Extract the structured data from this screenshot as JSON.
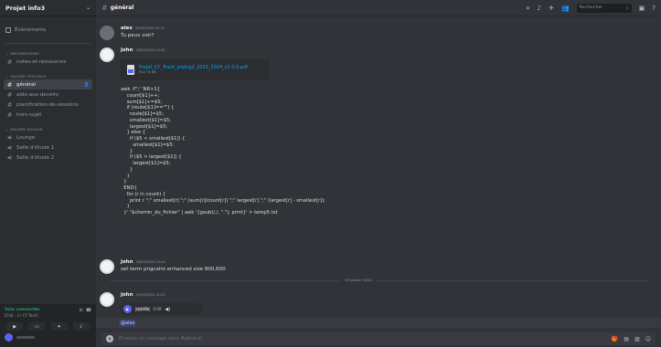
{
  "server": {
    "name": "Projet info3",
    "chevron_icon": "chevron-down-icon"
  },
  "sidebar": {
    "events_label": "Événements",
    "categories": [
      {
        "label": "INFORMATIONS",
        "channels": [
          {
            "label": "notes-et-ressources",
            "type": "text"
          }
        ]
      },
      {
        "label": "SALONS TEXTUELS",
        "channels": [
          {
            "label": "général",
            "type": "text",
            "active": true
          },
          {
            "label": "aide-aux-devoirs",
            "type": "text"
          },
          {
            "label": "planification-de-sessions",
            "type": "text"
          },
          {
            "label": "hors-sujet",
            "type": "text"
          }
        ]
      },
      {
        "label": "SALONS VOCAUX",
        "channels": [
          {
            "label": "Lounge",
            "type": "voice"
          },
          {
            "label": "Salle d'étude 1",
            "type": "voice"
          },
          {
            "label": "Salle d'étude 2",
            "type": "voice"
          }
        ]
      }
    ]
  },
  "voice_panel": {
    "status": "Voix connectée",
    "sub": "[CS4 - 3 / CY Tech]"
  },
  "topbar": {
    "channel": "général",
    "search_placeholder": "Rechercher"
  },
  "messages": [
    {
      "author": "alex",
      "timestamp": "28/05/2024 22:11",
      "text": "Tu peux voir?"
    },
    {
      "author": "john",
      "timestamp": "28/05/2024 22:30",
      "attachment": {
        "name": "Projet_CY_Truck_preIng2_2023_2024_v1.0.0.pdf",
        "size": "912,74 KB"
      }
    },
    {
      "author": "john",
      "timestamp": "28/05/2024 23:43",
      "text": "set term pngcairo enhanced size 800,600"
    },
    {
      "author": "john",
      "timestamp": "29/05/2024 11:02",
      "voice": {
        "duration": "0:09"
      },
      "mention": "@alex"
    }
  ],
  "code_lines": [
    "awk -F';' 'NR>1{",
    "    count[$1]++;",
    "    sum[$1]+=$5;",
    "    if (route[$1]==\"\") {",
    "      route[$1]=$5;",
    "      smallest[$1]=$5;",
    "      largest[$1]=$5;",
    "    } else {",
    "      if ($5 < smallest[$1]) {",
    "        smallest[$1]=$5;",
    "      }",
    "      if ($5 > largest[$1]) {",
    "        largest[$1]=$5;",
    "      }",
    "    }",
    "  }",
    "  END{",
    "    for (r in count) {",
    "      print r \";\" smallest[r] \";\" (sum[r]/count[r]) \";\" largest[r] \";\" (largest[r] - smallest[r]);",
    "    }",
    "  }' \"$chemin_du_fichier\" | awk '{gsub(/,/, \".\"); print}' > temp5.txt"
  ],
  "day_separator": "29 janvier 2024",
  "composer": {
    "placeholder": "Envoyer un message dans #général"
  }
}
